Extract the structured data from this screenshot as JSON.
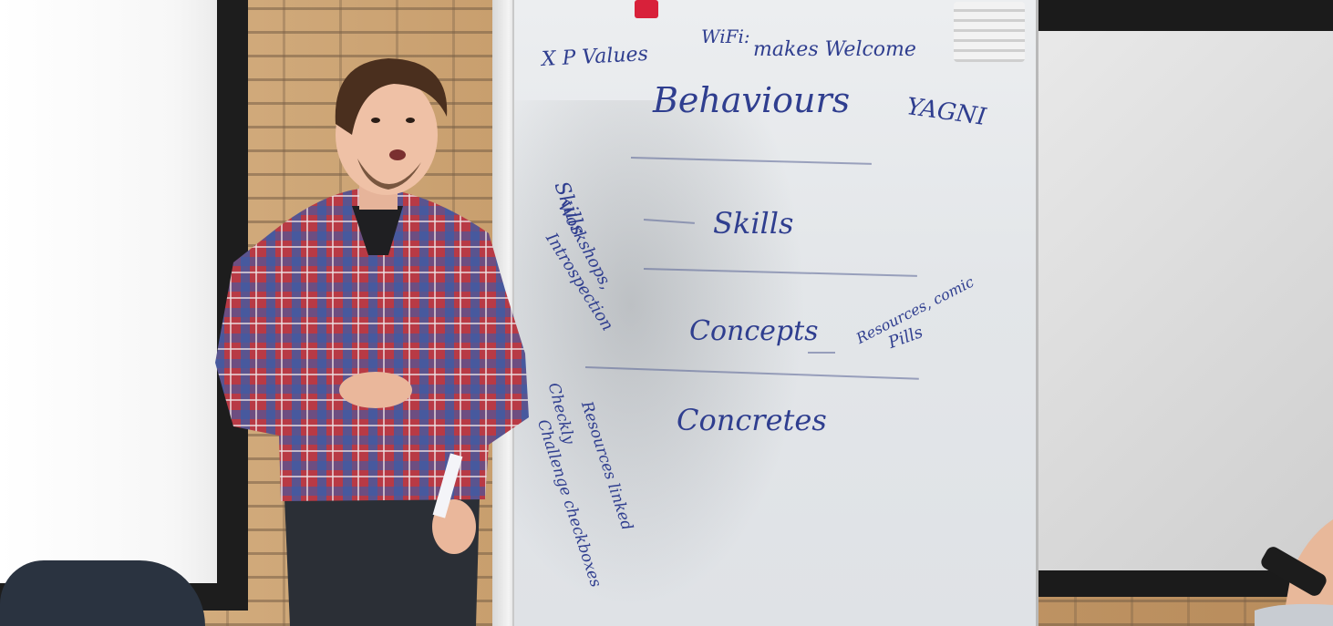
{
  "board": {
    "xp_values": "X P Values",
    "wifi": "WiFi:",
    "makes_welcome": "makes Welcome",
    "yagni": "YAGNI",
    "behaviours": "Behaviours",
    "skills_main": "Skills",
    "skills_side": "Skills",
    "workshops": "Workshops,",
    "introspection": "Introspection",
    "concepts": "Concepts",
    "resources_comic": "Resources, comic",
    "pills": "Pills",
    "concretes": "Concretes",
    "resources_linked": "Resources linked",
    "checkly": "Checkly",
    "challenge_checkboxes": "Challenge checkboxes"
  },
  "colors": {
    "marker": "#2f3e8f",
    "shirt_red": "#b83a45",
    "shirt_blue": "#3b5ca8",
    "trousers": "#2b2f36"
  }
}
